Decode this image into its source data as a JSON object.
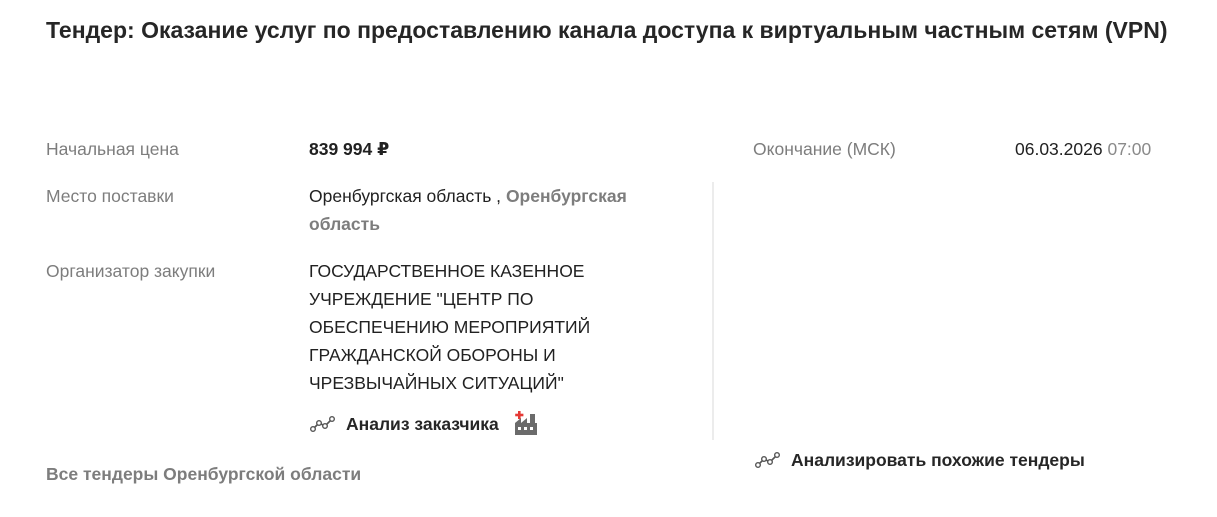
{
  "tender": {
    "title": "Тендер: Оказание услуг по предоставлению канала доступа к виртуальным частным сетям (VPN)"
  },
  "fields": {
    "price_label": "Начальная цена",
    "price_value": "839 994 ₽",
    "place_label": "Место поставки",
    "place_region": "Оренбургская область ,",
    "place_region_link": "Оренбургская область",
    "organizer_label": "Организатор закупки",
    "organizer_value": "ГОСУДАРСТВЕННОЕ КАЗЕННОЕ УЧРЕЖДЕНИЕ \"ЦЕНТР ПО ОБЕСПЕЧЕНИЮ МЕРОПРИЯТИЙ ГРАЖДАНСКОЙ ОБОРОНЫ И ЧРЕЗВЫЧАЙНЫХ СИТУАЦИЙ\"",
    "end_label": "Окончание (МСК)",
    "end_date": "06.03.2026",
    "end_time": "07:00"
  },
  "actions": {
    "customer_analysis": "Анализ заказчика",
    "analyze_similar": "Анализировать похожие тендеры",
    "all_region_tenders": "Все тендеры Оренбургской области"
  },
  "icons": {
    "analysis": "trend-line-icon",
    "factory": "factory-icon"
  },
  "colors": {
    "label": "#7d7d7d",
    "text": "#212121",
    "factory_red": "#e53935"
  }
}
